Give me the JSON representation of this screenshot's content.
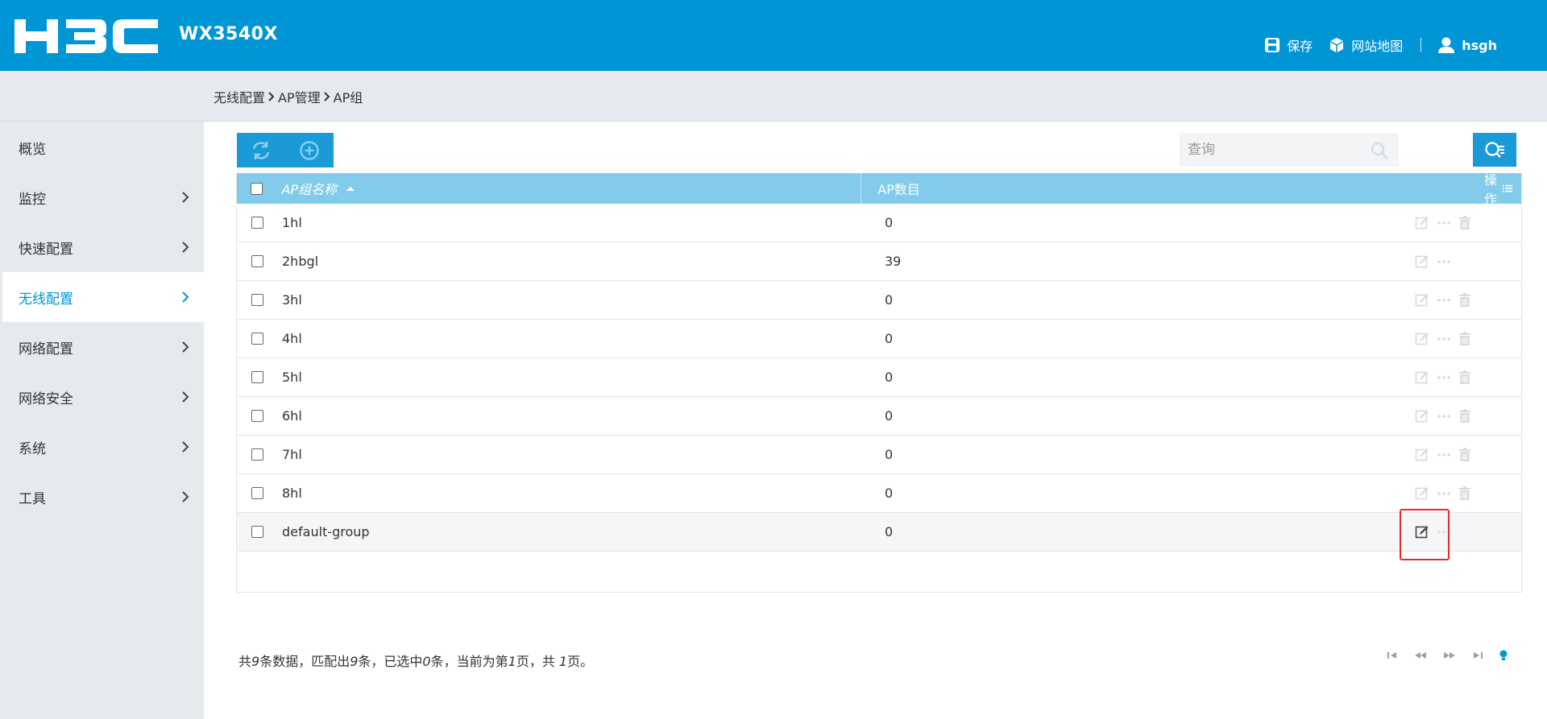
{
  "header": {
    "logo_text": "H3C",
    "model": "WX3540X",
    "save_label": "保存",
    "sitemap_label": "网站地图",
    "user_label": "hsgh"
  },
  "breadcrumb": [
    "无线配置",
    "AP管理",
    "AP组"
  ],
  "sidebar": {
    "items": [
      {
        "label": "概览",
        "has_arrow": false,
        "active": false
      },
      {
        "label": "监控",
        "has_arrow": true,
        "active": false
      },
      {
        "label": "快速配置",
        "has_arrow": true,
        "active": false
      },
      {
        "label": "无线配置",
        "has_arrow": true,
        "active": true
      },
      {
        "label": "网络配置",
        "has_arrow": true,
        "active": false
      },
      {
        "label": "网络安全",
        "has_arrow": true,
        "active": false
      },
      {
        "label": "系统",
        "has_arrow": true,
        "active": false
      },
      {
        "label": "工具",
        "has_arrow": true,
        "active": false
      }
    ]
  },
  "search": {
    "placeholder": "查询"
  },
  "table": {
    "headers": {
      "name": "AP组名称",
      "count": "AP数目",
      "ops": "操作"
    },
    "rows": [
      {
        "name": "1hl",
        "count": "0",
        "deletable": true
      },
      {
        "name": "2hbgl",
        "count": "39",
        "deletable": false
      },
      {
        "name": "3hl",
        "count": "0",
        "deletable": true
      },
      {
        "name": "4hl",
        "count": "0",
        "deletable": true
      },
      {
        "name": "5hl",
        "count": "0",
        "deletable": true
      },
      {
        "name": "6hl",
        "count": "0",
        "deletable": true
      },
      {
        "name": "7hl",
        "count": "0",
        "deletable": true
      },
      {
        "name": "8hl",
        "count": "0",
        "deletable": true
      },
      {
        "name": "default-group",
        "count": "0",
        "deletable": false
      }
    ]
  },
  "footer": {
    "t1": "共",
    "total": "9",
    "t2": "条数据，匹配出",
    "matched": "9",
    "t3": "条，已选中",
    "selected": "0",
    "t4": "条，当前为第",
    "page": "1",
    "t5": "页，共 ",
    "pages": "1",
    "t6": "页。"
  },
  "colors": {
    "brand": "#0096d6",
    "table_header": "#82cbea",
    "highlight": "#e8282b"
  }
}
